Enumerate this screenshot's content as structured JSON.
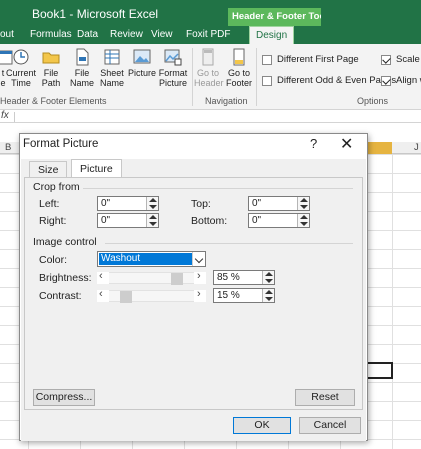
{
  "app": {
    "window_title": "Book1 - Microsoft Excel",
    "context_tab_title": "Header & Footer Tools"
  },
  "ribbon_tabs": [
    "out",
    "Formulas",
    "Data",
    "Review",
    "View",
    "Foxit PDF",
    "Design"
  ],
  "ribbon": {
    "elements_buttons": [
      {
        "label1": "t",
        "label2": "e",
        "icon": "date-icon"
      },
      {
        "label1": "Current",
        "label2": "Time",
        "icon": "clock-icon"
      },
      {
        "label1": "File",
        "label2": "Path",
        "icon": "folder-icon"
      },
      {
        "label1": "File",
        "label2": "Name",
        "icon": "file-icon"
      },
      {
        "label1": "Sheet",
        "label2": "Name",
        "icon": "sheet-icon"
      },
      {
        "label1": "Picture",
        "label2": "",
        "icon": "picture-icon"
      },
      {
        "label1": "Format",
        "label2": "Picture",
        "icon": "format-picture-icon"
      }
    ],
    "elements_group": "Header & Footer Elements",
    "navigation_buttons": [
      {
        "label1": "Go to",
        "label2": "Header",
        "icon": "go-to-header-icon",
        "disabled": true
      },
      {
        "label1": "Go to",
        "label2": "Footer",
        "icon": "go-to-footer-icon",
        "disabled": false
      }
    ],
    "navigation_group": "Navigation",
    "options": [
      {
        "label": "Different First Page",
        "checked": false
      },
      {
        "label": "Different Odd & Even Pages",
        "checked": false
      },
      {
        "label": "Scale w",
        "checked": true
      },
      {
        "label": "Align w",
        "checked": true
      }
    ],
    "options_group": "Options"
  },
  "formula_bar": {
    "fx": "fx"
  },
  "columns": {
    "left": "B",
    "right": "J"
  },
  "dialog": {
    "title": "Format Picture",
    "help": "?",
    "close": "✕",
    "tabs": [
      "Size",
      "Picture"
    ],
    "active_tab": "Picture",
    "crop_from": {
      "heading": "Crop from",
      "left_label": "Left:",
      "left_value": "0\"",
      "right_label": "Right:",
      "right_value": "0\"",
      "top_label": "Top:",
      "top_value": "0\"",
      "bottom_label": "Bottom:",
      "bottom_value": "0\""
    },
    "image_control": {
      "heading": "Image control",
      "color_label": "Color:",
      "color_value": "Washout",
      "brightness_label": "Brightness:",
      "brightness_value": "85 %",
      "brightness_fraction": 0.85,
      "contrast_label": "Contrast:",
      "contrast_value": "15 %",
      "contrast_fraction": 0.15
    },
    "compress_label": "Compress...",
    "reset_label": "Reset",
    "ok_label": "OK",
    "cancel_label": "Cancel"
  },
  "colors": {
    "excel_green": "#217346",
    "context_tab": "#5cb85c",
    "selected_column": "#e6b441",
    "highlight": "#0078d7"
  }
}
